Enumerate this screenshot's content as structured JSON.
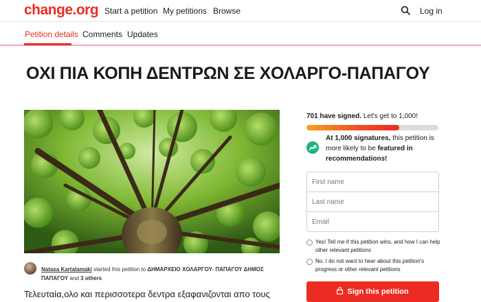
{
  "header": {
    "logo": "change.org",
    "nav": [
      "Start a petition",
      "My petitions",
      "Browse"
    ],
    "login": "Log in"
  },
  "tabs": [
    {
      "label": "Petition details",
      "active": true
    },
    {
      "label": "Comments",
      "active": false
    },
    {
      "label": "Updates",
      "active": false
    }
  ],
  "petition": {
    "title": "ΟΧΙ ΠΙΑ ΚΟΠΗ ΔΕΝΤΡΩΝ ΣΕ ΧΟΛΑΡΓΟ-ΠΑΠΑΓΟΥ",
    "starter_name": "Natasa Kartalamaki",
    "starter_mid": "started this petition to",
    "starter_target": "ΔΗΜΑΡΧΕΙΟ ΧΟΛΑΡΓΟΥ- ΠΑΠΑΓΟΥ ΔΗΜΟΣ ΠΑΠΑΓΟΥ",
    "starter_and": "and",
    "starter_others": "3 others",
    "body": "Τελευταία,ολο και περισσοτερα δεντρα εξαφανιζονται  απο τους"
  },
  "sidebar": {
    "signed_count": "701 have signed.",
    "signed_goal": "Let's get to 1,000!",
    "progress_fraction": 0.701,
    "rec_bold1": "At 1,000 signatures,",
    "rec_text1": "this petition is more likely to be",
    "rec_bold2": "featured in recommendations!",
    "first_name_placeholder": "First name",
    "last_name_placeholder": "Last name",
    "email_placeholder": "Email",
    "opt_yes": "Yes! Tell me if this petition wins, and how I can help other relevant petitions",
    "opt_no": "No. I do not want to hear about this petition's progress or other relevant petitions",
    "sign_label": "Sign this petition"
  },
  "colors": {
    "brand": "#ec2c22",
    "progress_start": "#f7a21b",
    "success": "#1fb57d"
  },
  "icons": [
    "search-icon",
    "trending-up-icon",
    "lock-icon"
  ]
}
